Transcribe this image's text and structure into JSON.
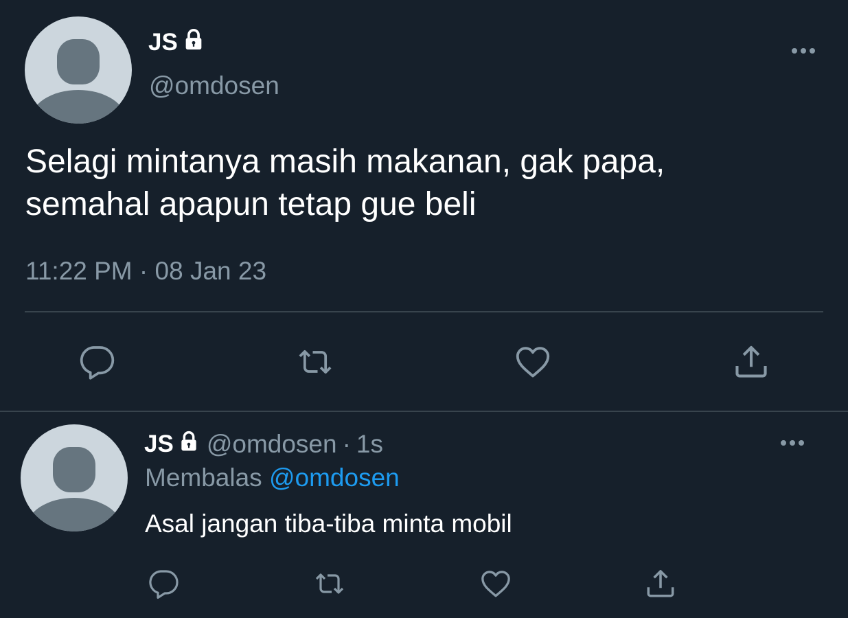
{
  "main_tweet": {
    "display_name": "JS",
    "handle": "@omdosen",
    "text_line1": "Selagi mintanya masih makanan, gak papa,",
    "text_line2": "semahal apapun tetap gue beli",
    "timestamp": "11:22 PM · 08 Jan 23",
    "icons": {
      "lock": "lock-icon",
      "more": "more-horizontal-icon",
      "reply": "reply-icon",
      "retweet": "retweet-icon",
      "like": "heart-icon",
      "share": "share-icon"
    }
  },
  "reply_tweet": {
    "display_name": "JS",
    "handle": "@omdosen",
    "separator": "·",
    "time_ago": "1s",
    "replying_label": "Membalas",
    "replying_handle": "@omdosen",
    "text": "Asal jangan tiba-tiba minta mobil"
  },
  "colors": {
    "background": "#16202b",
    "primary_text": "#ffffff",
    "secondary_text": "#8899a6",
    "link": "#1d9bf0",
    "divider": "#38444d"
  }
}
